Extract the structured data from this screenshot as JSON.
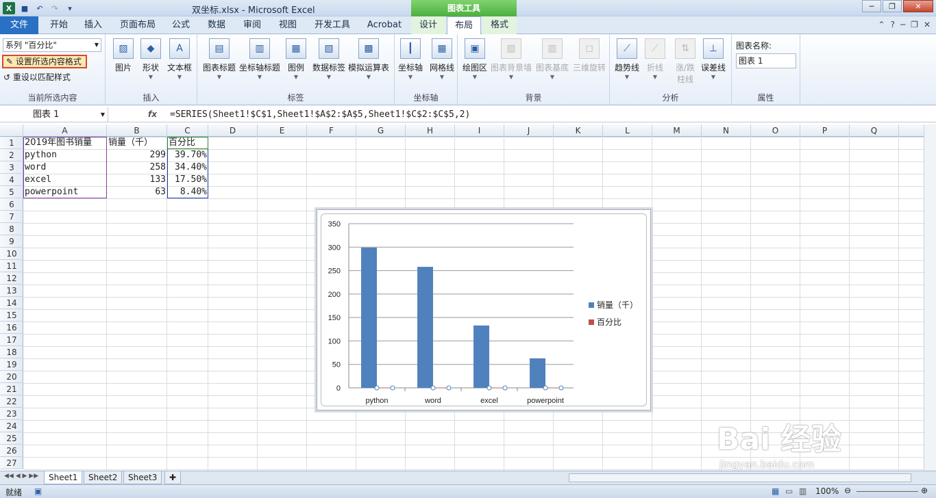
{
  "app": {
    "title": "双坐标.xlsx  -  Microsoft Excel",
    "context_tool": "图表工具",
    "window_min": "─",
    "window_restore": "❐",
    "window_close": "✕"
  },
  "tabs": [
    "文件",
    "开始",
    "插入",
    "页面布局",
    "公式",
    "数据",
    "审阅",
    "视图",
    "开发工具",
    "Acrobat",
    "设计",
    "布局",
    "格式"
  ],
  "active_tab": "布局",
  "ribbon": {
    "current_selection": {
      "combo_value": "系列 \"百分比\"",
      "format_button": "设置所选内容格式",
      "reset_button": "重设以匹配样式",
      "group_label": "当前所选内容"
    },
    "insert": {
      "items": [
        "图片",
        "形状",
        "文本框"
      ],
      "group_label": "插入"
    },
    "labels": {
      "items": [
        "图表标题",
        "坐标轴标题",
        "图例",
        "数据标签",
        "模拟运算表"
      ],
      "group_label": "标签"
    },
    "axes": {
      "items": [
        "坐标轴",
        "网格线"
      ],
      "group_label": "坐标轴"
    },
    "background": {
      "items": [
        "绘图区",
        "图表背景墙",
        "图表基底",
        "三维旋转"
      ],
      "group_label": "背景"
    },
    "analysis": {
      "items": [
        "趋势线",
        "折线",
        "涨/跌\n柱线",
        "误差线"
      ],
      "group_label": "分析"
    },
    "properties": {
      "name_label": "图表名称:",
      "name_value": "图表 1",
      "group_label": "属性"
    }
  },
  "formula_bar": {
    "name_box": "图表 1",
    "fx": "fx",
    "formula": "=SERIES(Sheet1!$C$1,Sheet1!$A$2:$A$5,Sheet1!$C$2:$C$5,2)"
  },
  "columns": [
    "A",
    "B",
    "C",
    "D",
    "E",
    "F",
    "G",
    "H",
    "I",
    "J",
    "K",
    "L",
    "M",
    "N",
    "O",
    "P",
    "Q"
  ],
  "rows": [
    "1",
    "2",
    "3",
    "4",
    "5",
    "6",
    "7",
    "8",
    "9",
    "10",
    "11",
    "12",
    "13",
    "14",
    "15",
    "16",
    "17",
    "18",
    "19",
    "20",
    "21",
    "22",
    "23",
    "24",
    "25",
    "26",
    "27"
  ],
  "cells": {
    "header": [
      "2019年图书销量",
      "销量（千）",
      "百分比"
    ],
    "data": [
      [
        "python",
        "299",
        "39.70%"
      ],
      [
        "word",
        "258",
        "34.40%"
      ],
      [
        "excel",
        "133",
        "17.50%"
      ],
      [
        "powerpoint",
        "63",
        "8.40%"
      ]
    ]
  },
  "chart_data": {
    "type": "bar",
    "categories": [
      "python",
      "word",
      "excel",
      "powerpoint"
    ],
    "series": [
      {
        "name": "销量（千）",
        "values": [
          299,
          258,
          133,
          63
        ],
        "color": "#4f81bd"
      },
      {
        "name": "百分比",
        "values": [
          0.397,
          0.344,
          0.175,
          0.084
        ],
        "color": "#c0504d"
      }
    ],
    "ylim": [
      0,
      350
    ],
    "yticks": [
      0,
      50,
      100,
      150,
      200,
      250,
      300,
      350
    ],
    "grid": true,
    "legend": "right"
  },
  "sheet_tabs": [
    "Sheet1",
    "Sheet2",
    "Sheet3"
  ],
  "active_sheet": "Sheet1",
  "status": {
    "ready": "就绪",
    "zoom": "100%"
  },
  "watermark": {
    "text": "Bai 经验",
    "url": "jingyan.baidu.com"
  }
}
